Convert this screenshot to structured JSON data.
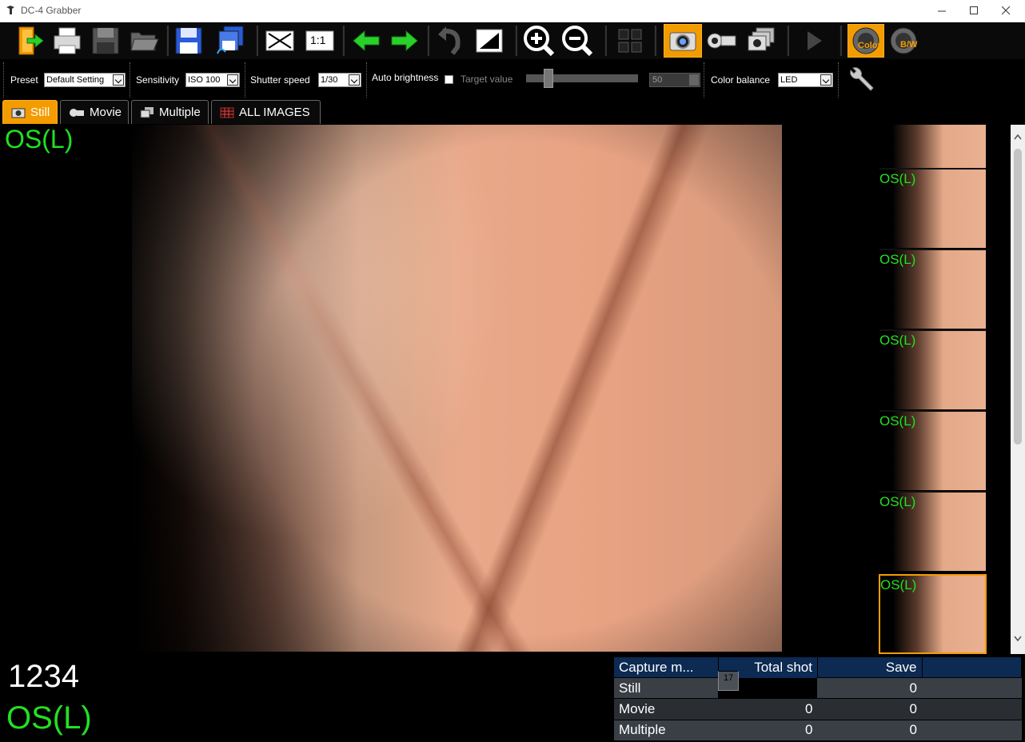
{
  "window": {
    "title": "DC-4 Grabber"
  },
  "settings": {
    "preset_label": "Preset",
    "preset_value": "Default Setting",
    "sensitivity_label": "Sensitivity",
    "sensitivity_value": "ISO 100",
    "shutter_label": "Shutter speed",
    "shutter_value": "1/30",
    "auto_brightness_label": "Auto brightness",
    "target_label": "Target value",
    "target_value": "50",
    "color_balance_label": "Color balance",
    "color_balance_value": "LED"
  },
  "toolbar": {
    "color_label": "Color",
    "bw_label": "B/W",
    "one_to_one_label": "1:1"
  },
  "tabs": [
    {
      "label": "Still",
      "icon": "camera-icon",
      "active": true
    },
    {
      "label": "Movie",
      "icon": "video-camera-icon",
      "active": false
    },
    {
      "label": "Multiple",
      "icon": "multi-camera-icon",
      "active": false
    },
    {
      "label": "ALL IMAGES",
      "icon": "grid-images-icon",
      "active": false
    }
  ],
  "main": {
    "eye_label": "OS(L)"
  },
  "thumbnails": [
    {
      "label": ""
    },
    {
      "label": "OS(L)"
    },
    {
      "label": "OS(L)"
    },
    {
      "label": "OS(L)"
    },
    {
      "label": "OS(L)"
    },
    {
      "label": "OS(L)"
    },
    {
      "label": "OS(L)"
    }
  ],
  "bottom": {
    "patient_id": "1234",
    "eye_label": "OS(L)"
  },
  "stats": {
    "headers": [
      "Capture m...",
      "Total shot",
      "Save"
    ],
    "rows": [
      {
        "mode": "Still",
        "total": "17",
        "save": "0"
      },
      {
        "mode": "Movie",
        "total": "0",
        "save": "0"
      },
      {
        "mode": "Multiple",
        "total": "0",
        "save": "0"
      }
    ]
  },
  "colors": {
    "accent": "#f39c00",
    "label_green": "#22e022",
    "header_blue": "#0c2a52"
  }
}
